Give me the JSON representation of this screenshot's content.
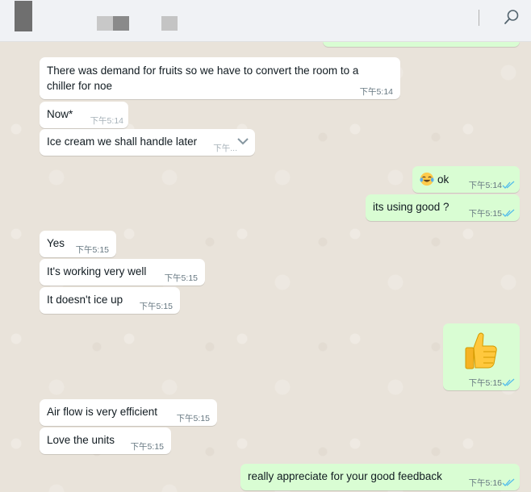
{
  "header": {
    "search_icon": "search-icon"
  },
  "messages": [
    {
      "dir": "in",
      "text_line1": "There was demand for fruits so we have to convert the room to a",
      "text_line2": "chiller for noe",
      "time": "下午5:14"
    },
    {
      "dir": "in",
      "text": "Now*",
      "time": "下午5:14"
    },
    {
      "dir": "in",
      "text": "Ice cream we shall handle later",
      "time": "下午..."
    },
    {
      "dir": "out",
      "text": "ok",
      "emoji": "laughing-tears-emoji",
      "time": "下午5:14",
      "status": "read"
    },
    {
      "dir": "out",
      "text": "its using good ?",
      "time": "下午5:15",
      "status": "read"
    },
    {
      "dir": "in",
      "text": "Yes",
      "time": "下午5:15"
    },
    {
      "dir": "in",
      "text": "It's working very well",
      "time": "下午5:15"
    },
    {
      "dir": "in",
      "text": "It doesn't ice up",
      "time": "下午5:15"
    },
    {
      "dir": "out",
      "emoji": "thumbs-up-emoji",
      "time": "下午5:15",
      "status": "read"
    },
    {
      "dir": "in",
      "text": "Air flow is very efficient",
      "time": "下午5:15"
    },
    {
      "dir": "in",
      "text": "Love the units",
      "time": "下午5:15"
    },
    {
      "dir": "out",
      "text": "really appreciate for your good feedback",
      "time": "下午5:16",
      "status": "read"
    }
  ],
  "colors": {
    "incoming_bubble": "#ffffff",
    "outgoing_bubble": "#d9fdd3",
    "read_ticks": "#53bdeb",
    "chat_background": "#e9e3da"
  }
}
